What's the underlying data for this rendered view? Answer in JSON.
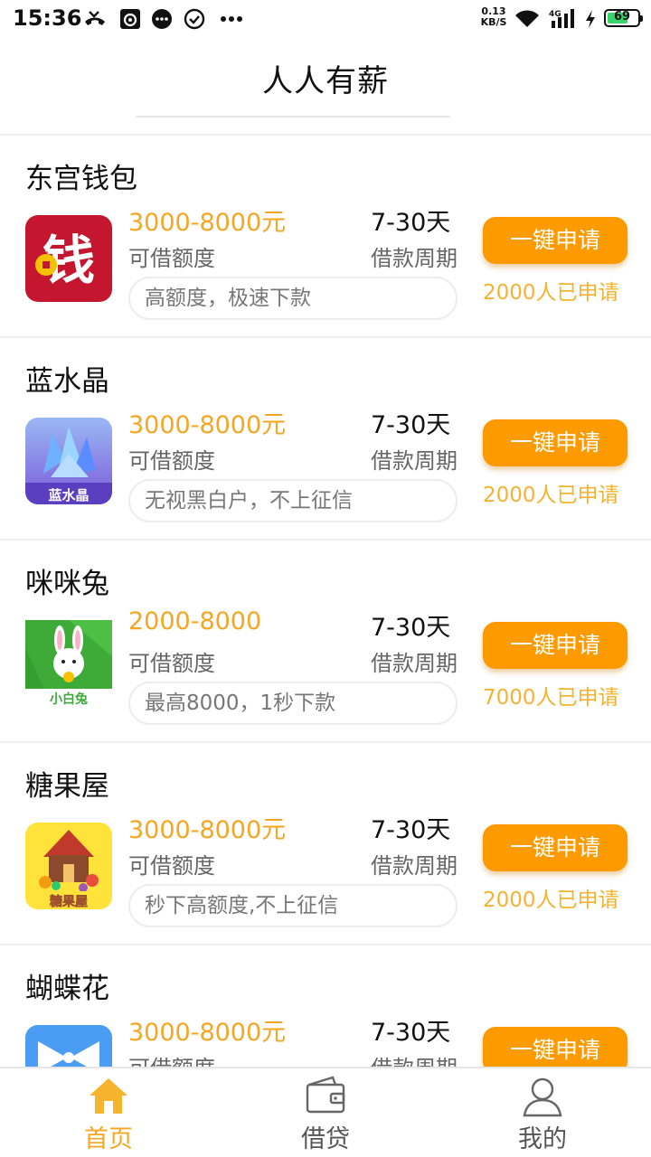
{
  "status_bar": {
    "time": "15:36",
    "net_speed_value": "0.13",
    "net_speed_unit": "KB/S",
    "network_type": "4G",
    "battery_level": "69",
    "icons": [
      "missed-call-icon",
      "app-notification-icon",
      "message-icon",
      "check-circle-icon",
      "more-dots-icon",
      "wifi-icon",
      "signal-icon",
      "charging-icon",
      "battery-icon"
    ]
  },
  "header": {
    "title": "人人有薪"
  },
  "colors": {
    "accent": "#fd9a00",
    "amount_text": "#f6a623",
    "count_text": "#f6b332",
    "battery_green": "#3ad36b"
  },
  "loans": [
    {
      "name": "东宫钱包",
      "logo": "wallet-logo",
      "amount": "3000-8000元",
      "amount_label": "可借额度",
      "term": "7-30天",
      "term_label": "借款周期",
      "tagline": "高额度，极速下款",
      "button": "一键申请",
      "count": "2000人已申请"
    },
    {
      "name": "蓝水晶",
      "logo": "crystal-logo",
      "logo_text": "蓝水晶",
      "amount": "3000-8000元",
      "amount_label": "可借额度",
      "term": "7-30天",
      "term_label": "借款周期",
      "tagline": "无视黑白户，不上征信",
      "button": "一键申请",
      "count": "2000人已申请"
    },
    {
      "name": "咪咪兔",
      "logo": "rabbit-logo",
      "logo_text": "小白兔",
      "amount": "2000-8000",
      "amount_label": "可借额度",
      "term": "7-30天",
      "term_label": "借款周期",
      "tagline": "最高8000，1秒下款",
      "button": "一键申请",
      "count": "7000人已申请"
    },
    {
      "name": "糖果屋",
      "logo": "candy-house-logo",
      "logo_text": "糖果屋",
      "amount": "3000-8000元",
      "amount_label": "可借额度",
      "term": "7-30天",
      "term_label": "借款周期",
      "tagline": "秒下高额度,不上征信",
      "button": "一键申请",
      "count": "2000人已申请"
    },
    {
      "name": "蝴蝶花",
      "logo": "bow-logo",
      "amount": "3000-8000元",
      "amount_label": "可借额度",
      "term": "7-30天",
      "term_label": "借款周期",
      "tagline": "",
      "button": "一键申请",
      "count": ""
    }
  ],
  "bottom_nav": [
    {
      "label": "首页",
      "icon": "home-icon",
      "active": true
    },
    {
      "label": "借贷",
      "icon": "wallet-icon",
      "active": false
    },
    {
      "label": "我的",
      "icon": "user-icon",
      "active": false
    }
  ]
}
